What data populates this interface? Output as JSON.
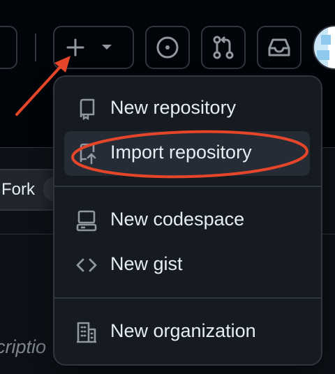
{
  "header": {
    "create_icon": "plus-icon",
    "dropdown_icon": "triangle-down-icon",
    "issues_icon": "issue-opened-icon",
    "pulls_icon": "git-pull-request-icon",
    "inbox_icon": "inbox-icon"
  },
  "repo": {
    "fork_label": "Fork",
    "description_fragment": "criptio"
  },
  "menu": {
    "items": [
      {
        "label": "New repository",
        "icon": "repo-icon"
      },
      {
        "label": "Import repository",
        "icon": "repo-push-icon",
        "highlighted": true
      },
      {
        "label": "New codespace",
        "icon": "codespaces-icon"
      },
      {
        "label": "New gist",
        "icon": "code-icon"
      },
      {
        "label": "New organization",
        "icon": "organization-icon"
      }
    ]
  },
  "colors": {
    "annotation": "#e5462a",
    "menu_bg": "#161b22",
    "text": "#e6edf3",
    "icon": "#9198a1"
  }
}
